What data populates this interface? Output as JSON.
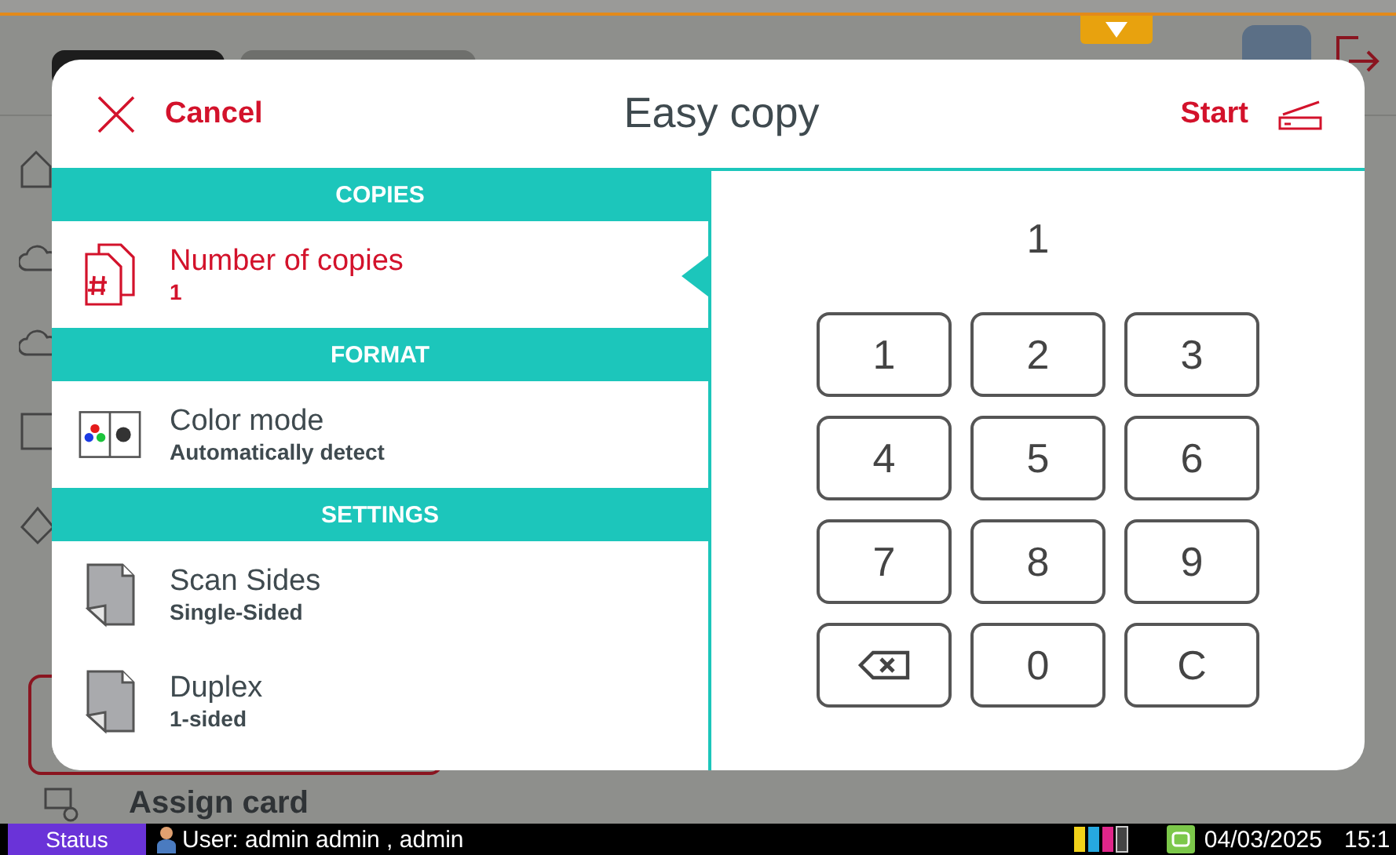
{
  "sidebar": {
    "items": [
      {
        "label": "Assign card"
      }
    ]
  },
  "dialog": {
    "title": "Easy copy",
    "cancel": "Cancel",
    "start": "Start",
    "sections": [
      {
        "title": "COPIES",
        "items": [
          {
            "kind": "copies",
            "label": "Number of copies",
            "value": "1",
            "selected": true
          }
        ]
      },
      {
        "title": "FORMAT",
        "items": [
          {
            "kind": "color",
            "label": "Color mode",
            "value": "Automatically detect",
            "selected": false
          }
        ]
      },
      {
        "title": "SETTINGS",
        "items": [
          {
            "kind": "sides",
            "label": "Scan Sides",
            "value": "Single-Sided",
            "selected": false
          },
          {
            "kind": "sides",
            "label": "Duplex",
            "value": "1-sided",
            "selected": false
          }
        ]
      }
    ],
    "display": "1",
    "keys": [
      {
        "kind": "digit",
        "label": "1"
      },
      {
        "kind": "digit",
        "label": "2"
      },
      {
        "kind": "digit",
        "label": "3"
      },
      {
        "kind": "digit",
        "label": "4"
      },
      {
        "kind": "digit",
        "label": "5"
      },
      {
        "kind": "digit",
        "label": "6"
      },
      {
        "kind": "digit",
        "label": "7"
      },
      {
        "kind": "digit",
        "label": "8"
      },
      {
        "kind": "digit",
        "label": "9"
      },
      {
        "kind": "backspace"
      },
      {
        "kind": "digit",
        "label": "0"
      },
      {
        "kind": "clear",
        "label": "C"
      }
    ]
  },
  "status_bar": {
    "status": "Status",
    "user": "User: admin admin , admin",
    "date": "04/03/2025",
    "time": "15:1"
  }
}
